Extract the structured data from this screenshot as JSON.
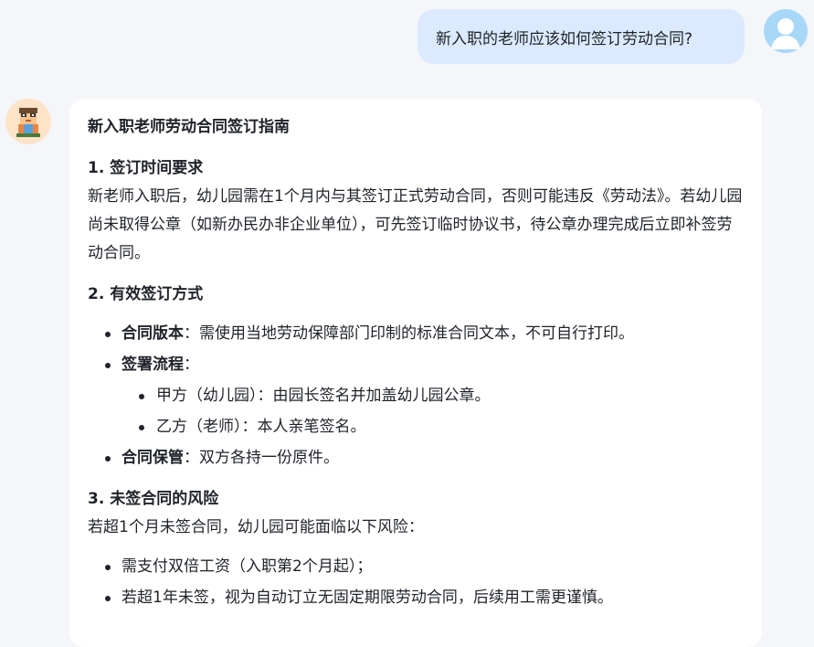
{
  "user_message": {
    "text": "新入职的老师应该如何签订劳动合同?"
  },
  "assistant_message": {
    "title": "新入职老师劳动合同签订指南",
    "section1": {
      "heading": "1. 签订时间要求",
      "paragraph": "新老师入职后，幼儿园需在1个月内与其签订正式劳动合同，否则可能违反《劳动法》。若幼儿园尚未取得公章（如新办民办非企业单位），可先签订临时协议书，待公章办理完成后立即补签劳动合同。"
    },
    "section2": {
      "heading": "2. 有效签订方式",
      "items": [
        {
          "label": "合同版本",
          "text": "：需使用当地劳动保障部门印制的标准合同文本，不可自行打印。"
        },
        {
          "label": "签署流程",
          "text": "："
        },
        {
          "label": "合同保管",
          "text": "：双方各持一份原件。"
        }
      ],
      "sub_items": [
        "甲方（幼儿园）：由园长签名并加盖幼儿园公章。",
        "乙方（老师）：本人亲笔签名。"
      ]
    },
    "section3": {
      "heading": "3. 未签合同的风险",
      "paragraph": "若超1个月未签合同，幼儿园可能面临以下风险：",
      "items": [
        "需支付双倍工资（入职第2个月起）；",
        "若超1年未签，视为自动订立无固定期限劳动合同，后续用工需更谨慎。"
      ]
    }
  },
  "colors": {
    "page_background": "#f4f6fa",
    "user_bubble": "#dbeafe",
    "card_background": "#ffffff",
    "user_avatar": "#a8d8f7",
    "bot_avatar": "#fde3c8"
  },
  "icons": {
    "user_avatar": "user-silhouette",
    "bot_avatar": "teacher-character"
  }
}
